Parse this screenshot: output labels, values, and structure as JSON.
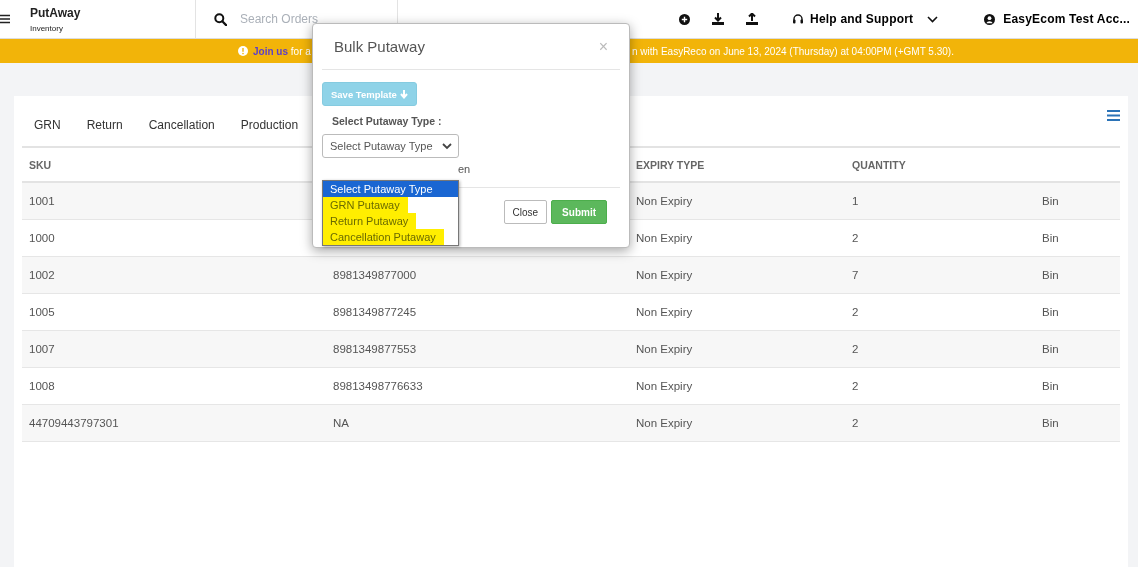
{
  "header": {
    "title": "PutAway",
    "subtitle": "Inventory",
    "search": {
      "placeholder": "Search Orders"
    },
    "help": "Help and Support",
    "help_menu": {
      "expanded": false
    },
    "account": "EasyEcom Test Acc..."
  },
  "banner": {
    "link": "Join us",
    "text_left": " for a",
    "text_right": "n with EasyReco on June 13, 2024 (Thursday) at 04:00PM (+GMT 5.30)."
  },
  "tabs": [
    "GRN",
    "Return",
    "Cancellation",
    "Production"
  ],
  "table": {
    "columns": [
      "SKU",
      "",
      "EXPIRY TYPE",
      "QUANTITY",
      ""
    ],
    "rows": [
      {
        "sku": "1001",
        "column_2": "",
        "expiry": "Non Expiry",
        "quantity": "1",
        "column_5": "Bin"
      },
      {
        "sku": "1000",
        "column_2": "",
        "expiry": "Non Expiry",
        "quantity": "2",
        "column_5": "Bin"
      },
      {
        "sku": "1002",
        "column_2": "8981349877000",
        "expiry": "Non Expiry",
        "quantity": "7",
        "column_5": "Bin"
      },
      {
        "sku": "1005",
        "column_2": "8981349877245",
        "expiry": "Non Expiry",
        "quantity": "2",
        "column_5": "Bin"
      },
      {
        "sku": "1007",
        "column_2": "8981349877553",
        "expiry": "Non Expiry",
        "quantity": "2",
        "column_5": "Bin"
      },
      {
        "sku": "1008",
        "column_2": "89813498776633",
        "expiry": "Non Expiry",
        "quantity": "2",
        "column_5": "Bin"
      },
      {
        "sku": "44709443797301",
        "column_2": "NA",
        "expiry": "Non Expiry",
        "quantity": "2",
        "column_5": "Bin"
      }
    ]
  },
  "modal": {
    "title": "Bulk Putaway",
    "close_glyph": "×",
    "save_template": "Save Template",
    "type_label": "Select Putaway Type :",
    "select_value": "Select Putaway Type",
    "note_fragment": "en",
    "options": [
      {
        "label": "Select Putaway Type",
        "selected": true,
        "highlighted": false
      },
      {
        "label": "GRN Putaway",
        "selected": false,
        "highlighted": true
      },
      {
        "label": "Return Putaway",
        "selected": false,
        "highlighted": true
      },
      {
        "label": "Cancellation Putaway",
        "selected": false,
        "highlighted": true
      }
    ],
    "buttons": [
      {
        "label": "Close",
        "kind": "default"
      },
      {
        "label": "Submit",
        "kind": "primary"
      }
    ]
  }
}
